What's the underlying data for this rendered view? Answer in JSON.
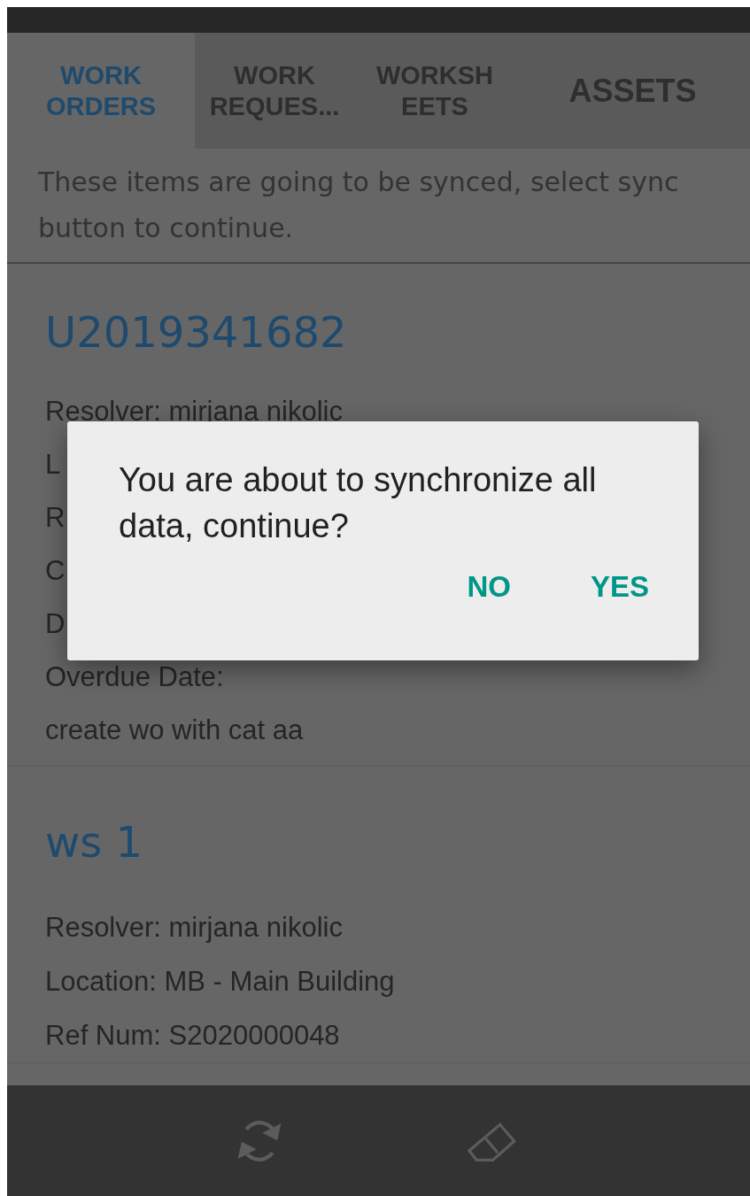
{
  "tabs": [
    {
      "label": "WORK\nORDERS",
      "selected": true
    },
    {
      "label": "WORK\nREQUES...",
      "selected": false
    },
    {
      "label": "WORKSH\nEETS",
      "selected": false
    },
    {
      "label": "ASSETS",
      "selected": false
    }
  ],
  "notice": "These items are going to be synced, select sync button to continue.",
  "cards": [
    {
      "title": "U2019341682",
      "fields": [
        "Resolver: mirjana nikolic",
        "L",
        "R",
        "C",
        "D",
        "Overdue Date:",
        "create wo with cat aa"
      ]
    },
    {
      "title": "ws 1",
      "fields": [
        "Resolver: mirjana nikolic",
        "Location: MB - Main Building",
        "Ref Num: S2020000048"
      ]
    }
  ],
  "dialog": {
    "message": "You are about to synchronize all data, continue?",
    "buttons": [
      "NO",
      "YES"
    ]
  }
}
